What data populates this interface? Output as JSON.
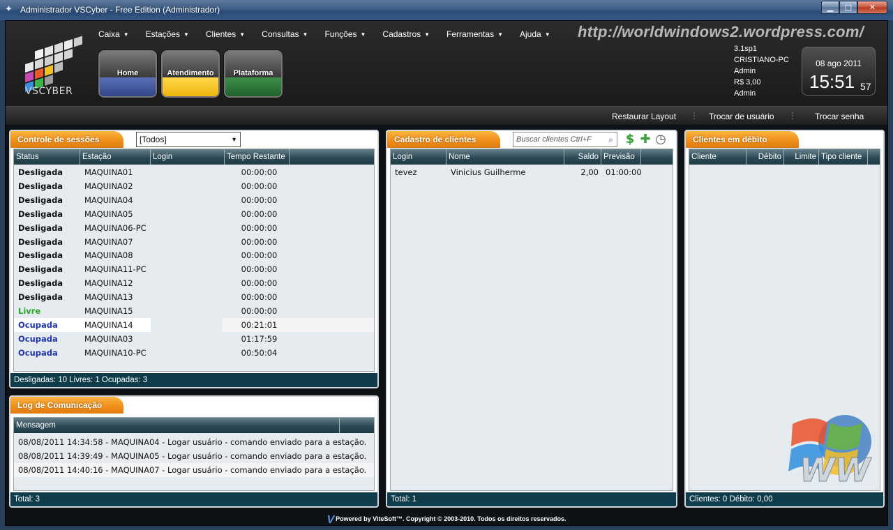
{
  "window": {
    "title": "Administrador VSCyber - Free Edition (Administrador)",
    "minimize": "▁",
    "maximize": "□",
    "close": "✕"
  },
  "logo": {
    "text": "VSCYBER"
  },
  "menu": [
    "Caixa",
    "Estações",
    "Clientes",
    "Consultas",
    "Funções",
    "Cadastros",
    "Ferramentas",
    "Ajuda"
  ],
  "big_buttons": [
    {
      "label": "Home",
      "color": "#3b4f95"
    },
    {
      "label": "Atendimento",
      "color": "#f5c317"
    },
    {
      "label": "Plataforma",
      "color": "#2e7a3a"
    }
  ],
  "watermark_url": "http://worldwindows2.wordpress.com/",
  "info": {
    "version": "3.1sp1",
    "machine": "CRISTIANO-PC",
    "user": "Admin",
    "balance": "R$ 3,00",
    "operator": "Admin"
  },
  "clock": {
    "date": "08 ago 2011",
    "time": "15:51",
    "seconds": "57"
  },
  "subbar": {
    "restore_layout": "Restaurar Layout",
    "switch_user": "Trocar de usuário",
    "change_password": "Trocar senha"
  },
  "sessions": {
    "title": "Controle de sessões",
    "filter": "[Todos]",
    "columns": [
      "Status",
      "Estação",
      "Login",
      "Tempo Restante"
    ],
    "rows": [
      {
        "status": "Desligada",
        "station": "MAQUINA01",
        "login": "",
        "time": "00:00:00"
      },
      {
        "status": "Desligada",
        "station": "MAQUINA02",
        "login": "",
        "time": "00:00:00"
      },
      {
        "status": "Desligada",
        "station": "MAQUINA04",
        "login": "",
        "time": "00:00:00"
      },
      {
        "status": "Desligada",
        "station": "MAQUINA05",
        "login": "",
        "time": "00:00:00"
      },
      {
        "status": "Desligada",
        "station": "MAQUINA06-PC",
        "login": "",
        "time": "00:00:00"
      },
      {
        "status": "Desligada",
        "station": "MAQUINA07",
        "login": "",
        "time": "00:00:00"
      },
      {
        "status": "Desligada",
        "station": "MAQUINA08",
        "login": "",
        "time": "00:00:00"
      },
      {
        "status": "Desligada",
        "station": "MAQUINA11-PC",
        "login": "",
        "time": "00:00:00"
      },
      {
        "status": "Desligada",
        "station": "MAQUINA12",
        "login": "",
        "time": "00:00:00"
      },
      {
        "status": "Desligada",
        "station": "MAQUINA13",
        "login": "",
        "time": "00:00:00"
      },
      {
        "status": "Livre",
        "station": "MAQUINA15",
        "login": "",
        "time": "00:00:00"
      },
      {
        "status": "Ocupada",
        "station": "MAQUINA14",
        "login": "",
        "time": "00:21:01"
      },
      {
        "status": "Ocupada",
        "station": "MAQUINA03",
        "login": "",
        "time": "01:17:59"
      },
      {
        "status": "Ocupada",
        "station": "MAQUINA10-PC",
        "login": "",
        "time": "00:50:04"
      }
    ],
    "footer": "Desligadas: 10 Livres: 1 Ocupadas: 3"
  },
  "log": {
    "title": "Log de Comunicação",
    "columns": [
      "Mensagem"
    ],
    "rows": [
      "08/08/2011 14:34:58 - MAQUINA04 - Logar usuário - comando enviado para a estação.",
      "08/08/2011 14:39:49 - MAQUINA05 - Logar usuário - comando enviado para a estação.",
      "08/08/2011 14:40:16 - MAQUINA07 - Logar usuário - comando enviado para a estação."
    ],
    "footer": "Total: 3"
  },
  "clients": {
    "title": "Cadastro de clientes",
    "search_placeholder": "Buscar clientes Ctrl+F",
    "columns": [
      "Login",
      "Nome",
      "Saldo",
      "Previsão"
    ],
    "rows": [
      {
        "login": "tevez",
        "name": "Vinicius Guilherme",
        "balance": "2,00",
        "forecast": "01:00:00"
      }
    ],
    "footer": "Total: 1",
    "icons": [
      "dollar-icon",
      "add-user-icon",
      "clock-icon"
    ]
  },
  "debt": {
    "title": "Clientes em débito",
    "columns": [
      "Cliente",
      "Débito",
      "Limite",
      "Tipo cliente"
    ],
    "footer": "Clientes: 0 Débito: 0,00"
  },
  "copyright": "Powered by ViteSoft™. Copyright © 2003-2010. Todos os direitos reservados.",
  "colors": {
    "panel_tab": "#f0901b",
    "grid_header": "#2c4a55",
    "footer_bar": "#0e3c4a",
    "status_livre": "#29a524",
    "status_ocupada": "#1f35a8"
  }
}
